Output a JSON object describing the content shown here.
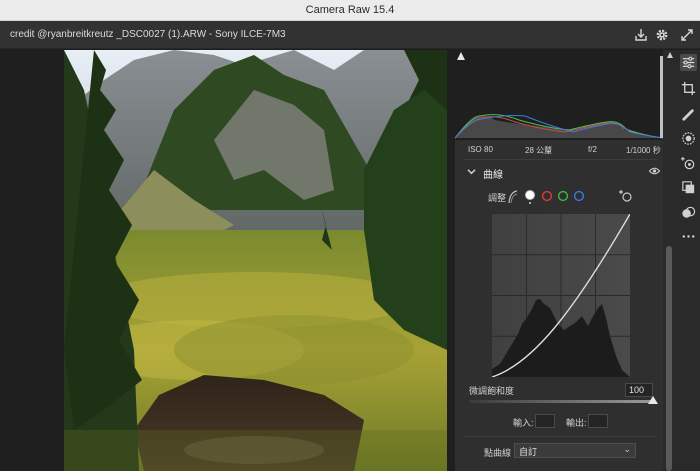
{
  "window": {
    "title": "Camera Raw 15.4"
  },
  "header": {
    "file_info": "credit @ryanbreitkreutz _DSC0027 (1).ARW  -  Sony ILCE-7M3",
    "icons": [
      "save-icon",
      "gear-icon",
      "fullscreen-icon"
    ]
  },
  "exif": {
    "iso": "ISO 80",
    "focal": "28 公釐",
    "aperture": "f/2",
    "shutter": "1/1000 秒"
  },
  "curve_panel": {
    "title": "曲線",
    "adjust_label": "調整",
    "mode_colors": [
      "#ffffff",
      "#e03a3a",
      "#3dbb3d",
      "#3a7be0"
    ],
    "refine_saturation_label": "微調飽和度",
    "refine_saturation_value": "100",
    "refine_saturation_fraction": 1.0,
    "input_label": "輸入:",
    "output_label": "輸出:",
    "input_value": "",
    "output_value": "",
    "point_curve_label": "點曲線",
    "point_curve_value": "自訂"
  },
  "toolbar": {
    "items": [
      "edit-sliders-icon",
      "crop-icon",
      "healing-icon",
      "mask-icon",
      "redeye-icon",
      "snapshot-icon",
      "presets-icon",
      "more-icon"
    ],
    "active": "edit-sliders-icon"
  }
}
